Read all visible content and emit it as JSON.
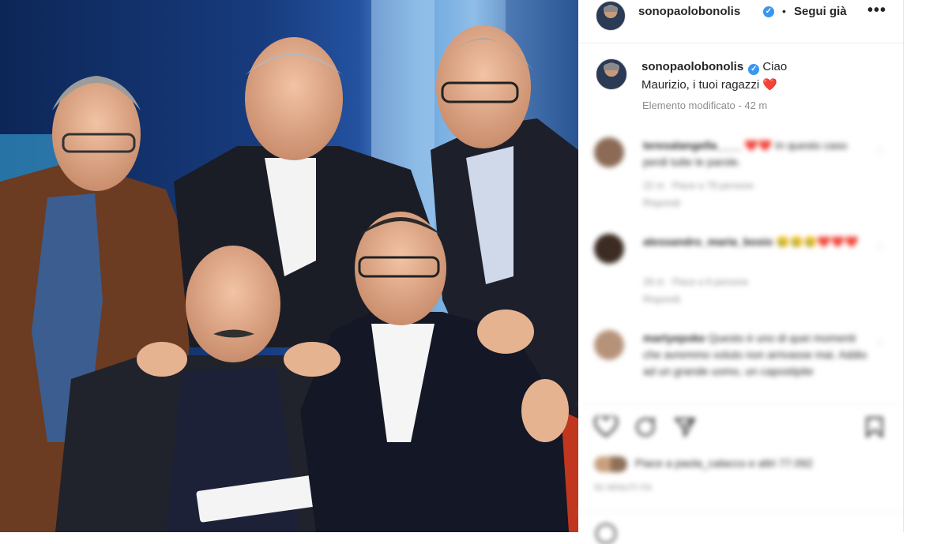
{
  "post": {
    "author": "sonopaolobonolis",
    "follow_label": "Segui già",
    "more_label": "•••",
    "separator": "•",
    "verified_mark": "✓",
    "caption": "Ciao Maurizio, i tuoi ragazzi ❤️",
    "edited_label": "Elemento modificato",
    "edited_time": "42 m"
  },
  "icons": {
    "like": "heart-icon",
    "comment": "comment-icon",
    "share": "share-icon",
    "save": "bookmark-icon",
    "comment_like": "heart-icon"
  },
  "comments": [
    {
      "user": "teresalangella____",
      "text": "❤️❤️ In questo caso perdi tutte le parole.",
      "time": "22 m",
      "likes": "Piace a 79 persone",
      "reply": "Rispondi",
      "avatar_color": "#8c6a55"
    },
    {
      "user": "alessandro_maria_bosio",
      "text": "😢😢😢❤️❤️❤️",
      "time": "28 m",
      "likes": "Piace a 6 persone",
      "reply": "Rispondi",
      "avatar_color": "#3b2b22"
    },
    {
      "user": "martyepoke",
      "text": "Questo è uno di quei momenti che avremmo voluto non arrivasse mai. Addio ad un grande uomo, un capostipite",
      "time": "",
      "likes": "",
      "reply": "",
      "avatar_color": "#b7927a"
    }
  ],
  "likes_summary": "Piace a paola_calacco e altri 77.092",
  "time_ago": "50 MINUTI FA",
  "colors": {
    "verified": "#3897f0",
    "heart": "#ed4956",
    "meta": "#8e8e8e",
    "bg_blue": "#163a7a"
  }
}
